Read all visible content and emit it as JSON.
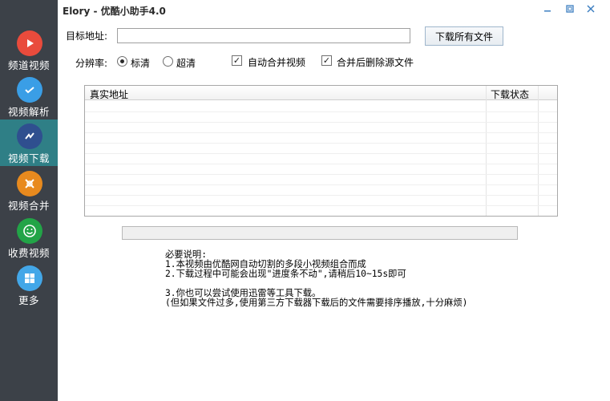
{
  "window": {
    "title": "Elory - 优酷小助手4.0"
  },
  "sidebar": {
    "items": [
      {
        "label": "频道视频",
        "icon": "play-icon",
        "color": "#e94b3c",
        "active": false
      },
      {
        "label": "视频解析",
        "icon": "check-icon",
        "color": "#3a9ee6",
        "active": false
      },
      {
        "label": "视频下载",
        "icon": "download-icon",
        "color": "#2f4f8f",
        "active": true
      },
      {
        "label": "视频合并",
        "icon": "merge-icon",
        "color": "#e88a1e",
        "active": false
      },
      {
        "label": "收费视频",
        "icon": "smile-icon",
        "color": "#22a447",
        "active": false
      },
      {
        "label": "更多",
        "icon": "windows-icon",
        "color": "#43a7e8",
        "active": false
      }
    ]
  },
  "form": {
    "target_label": "目标地址:",
    "target_value": "",
    "download_all": "下载所有文件",
    "resolution_label": "分辨率:",
    "res_standard": "标清",
    "res_super": "超清",
    "auto_merge": "自动合并视频",
    "delete_after": "合并后删除源文件"
  },
  "table": {
    "columns": [
      "真实地址",
      "下载状态"
    ],
    "rows": []
  },
  "progress": {
    "value": 0
  },
  "notes": {
    "title": "必要说明:",
    "line1": "1.本视频由优酷网自动切割的多段小视频组合而成",
    "line2": "2.下载过程中可能会出现\"进度条不动\",请稍后10~15s即可",
    "line3": "3.你也可以尝试使用迅雷等工具下载。",
    "line4": "(但如果文件过多,使用第三方下载器下载后的文件需要排序播放,十分麻烦)"
  }
}
